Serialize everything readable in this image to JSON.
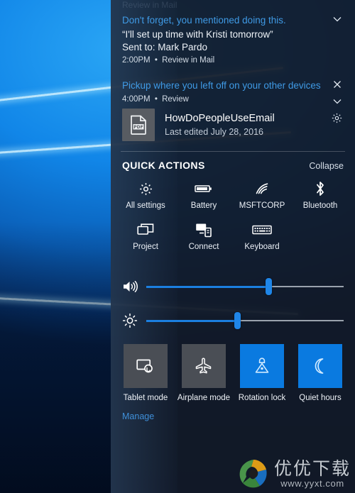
{
  "desktop": {
    "name": "windows-10-hero-wallpaper"
  },
  "action_center": {
    "clipped_notification": {
      "text": "Review in Mail"
    },
    "notifications": [
      {
        "title": "Don't forget, you mentioned doing this.",
        "quote": "“I'll set up time with Kristi tomorrow”",
        "sent_to": "Sent to: Mark Pardo",
        "time": "2:00PM",
        "separator": "•",
        "action": "Review in Mail",
        "chevron_icon": "chevron-down-icon"
      },
      {
        "title": "Pickup where you left off on your other devices",
        "time": "4:00PM",
        "separator": "•",
        "action": "Review",
        "close_icon": "close-icon",
        "chevron_icon": "chevron-down-icon",
        "settings_icon": "gear-icon",
        "file": {
          "thumbnail_icon": "pdf-file-icon",
          "name": "HowDoPeopleUseEmail",
          "subtitle": "Last edited July 28, 2016"
        }
      }
    ],
    "quick_actions": {
      "heading": "QUICK ACTIONS",
      "collapse_label": "Collapse",
      "row1": [
        {
          "icon": "gear-icon",
          "label": "All settings"
        },
        {
          "icon": "battery-icon",
          "label": "Battery"
        },
        {
          "icon": "wifi-icon",
          "label": "MSFTCORP"
        },
        {
          "icon": "bluetooth-icon",
          "label": "Bluetooth"
        }
      ],
      "row2": [
        {
          "icon": "project-icon",
          "label": "Project"
        },
        {
          "icon": "connect-icon",
          "label": "Connect"
        },
        {
          "icon": "keyboard-icon",
          "label": "Keyboard"
        }
      ]
    },
    "sliders": [
      {
        "name": "volume-slider",
        "icon": "speaker-icon",
        "value": 62
      },
      {
        "name": "brightness-slider",
        "icon": "brightness-icon",
        "value": 46
      }
    ],
    "tiles": [
      {
        "icon": "tablet-mode-icon",
        "label": "Tablet mode",
        "state": "off",
        "color": "#4a4e55"
      },
      {
        "icon": "airplane-icon",
        "label": "Airplane mode",
        "state": "off",
        "color": "#4a4e55"
      },
      {
        "icon": "rotation-lock-icon",
        "label": "Rotation lock",
        "state": "on",
        "color": "#0a7ae0"
      },
      {
        "icon": "moon-icon",
        "label": "Quiet hours",
        "state": "on",
        "color": "#0a7ae0"
      }
    ],
    "manage_label": "Manage"
  },
  "watermark": {
    "logo_icon": "yyxt-logo-icon",
    "title": "优优下载",
    "url": "www.yyxt.com"
  },
  "colors": {
    "accent": "#0a7ae0",
    "panel_bg": "#121a28",
    "link": "#3f9ae5",
    "tile_off": "#4a4e55"
  }
}
